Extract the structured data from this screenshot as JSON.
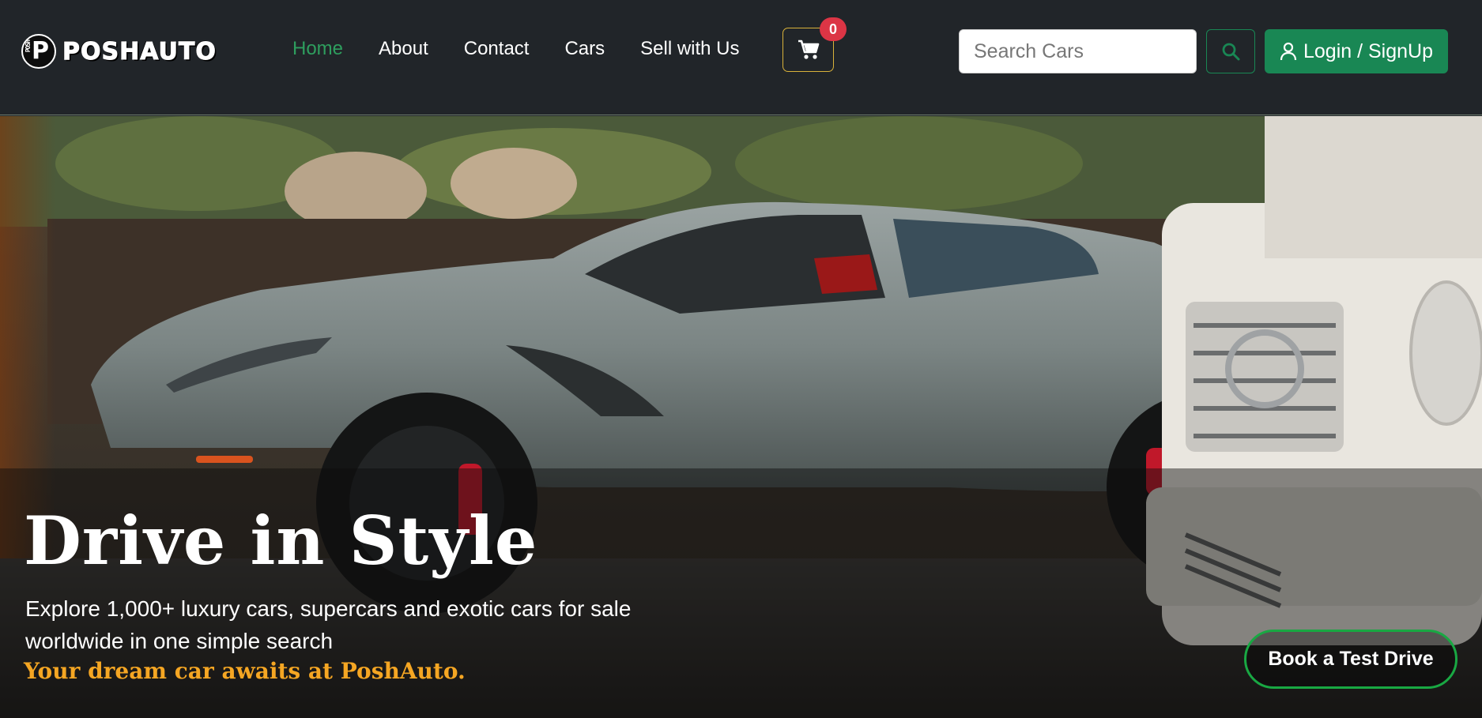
{
  "brand": {
    "name": "POSHAUTO",
    "logo_letter": "P",
    "logo_side_text": "POSH"
  },
  "nav": [
    {
      "label": "Home",
      "active": true
    },
    {
      "label": "About",
      "active": false
    },
    {
      "label": "Contact",
      "active": false
    },
    {
      "label": "Cars",
      "active": false
    },
    {
      "label": "Sell with Us",
      "active": false
    }
  ],
  "cart": {
    "icon": "cart-icon",
    "count": "0"
  },
  "search": {
    "placeholder": "Search Cars",
    "value": "",
    "icon": "search-icon"
  },
  "login": {
    "label": "Login / SignUp",
    "icon": "user-icon"
  },
  "hero": {
    "title": "Drive in Style",
    "subtitle": "Explore 1,000+ luxury cars, supercars and exotic cars for sale worldwide in one simple search",
    "tagline": "Your dream car awaits at PoshAuto.",
    "cta": "Book a Test Drive"
  },
  "colors": {
    "navbar_bg": "#212529",
    "accent_green": "#198754",
    "active_link": "#2e9e5e",
    "cart_border": "#d9b23a",
    "badge_red": "#dc3545",
    "tagline_orange": "#f5a623"
  }
}
